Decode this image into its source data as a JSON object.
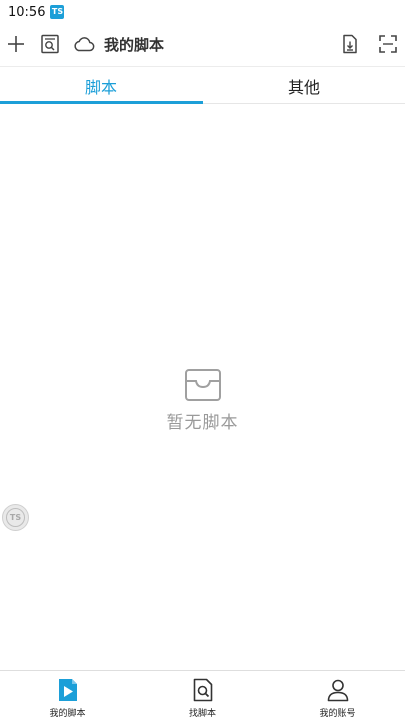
{
  "status_bar": {
    "time": "10:56",
    "app_icon_text": "TS"
  },
  "toolbar": {
    "title": "我的脚本",
    "icons": [
      "plus-icon",
      "search-script-icon",
      "cloud-icon",
      "import-file-icon",
      "scan-icon"
    ]
  },
  "tabs": [
    {
      "label": "脚本",
      "active": true
    },
    {
      "label": "其他",
      "active": false
    }
  ],
  "empty_state": {
    "text": "暂无脚本",
    "icon": "empty-inbox-icon"
  },
  "float_ball": {
    "text": "TS"
  },
  "bottom_nav": [
    {
      "label": "我的脚本",
      "icon": "play-file-icon",
      "active": true
    },
    {
      "label": "找脚本",
      "icon": "find-script-icon",
      "active": false
    },
    {
      "label": "我的账号",
      "icon": "user-icon",
      "active": false
    }
  ],
  "colors": {
    "accent": "#1c9fd8",
    "muted_text": "#9a9a9a",
    "divider": "#e6e6e6"
  }
}
